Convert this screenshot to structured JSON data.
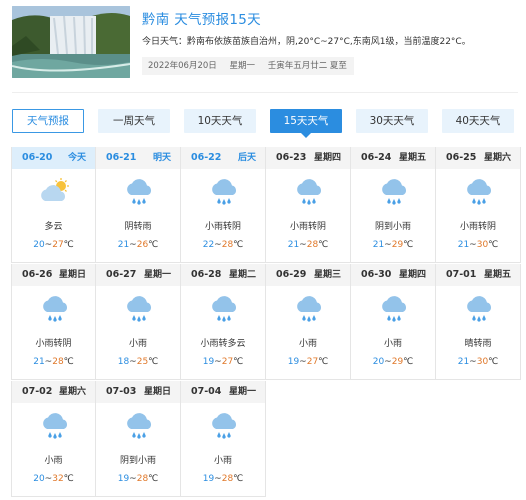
{
  "header": {
    "title": "黔南 天气预报15天",
    "summary": "今日天气：黔南布依族苗族自治州，阴,20°C~27°C,东南风1级，当前温度22°C。",
    "date": "2022年06月20日",
    "weekday": "星期一",
    "lunar": "壬寅年五月廿二 夏至",
    "thumb": "waterfall-photo"
  },
  "tabs": [
    {
      "label": "天气预报",
      "style": "outline"
    },
    {
      "label": "一周天气",
      "style": "normal"
    },
    {
      "label": "10天天气",
      "style": "normal"
    },
    {
      "label": "15天天气",
      "style": "active"
    },
    {
      "label": "30天天气",
      "style": "normal"
    },
    {
      "label": "40天天气",
      "style": "normal"
    }
  ],
  "colors": {
    "accent": "#2b8de0",
    "low_temp": "#2b8de0",
    "high_temp": "#e0782a"
  },
  "days": [
    {
      "date": "06-20",
      "week": "今天",
      "desc": "多云",
      "lo": "20",
      "hi": "27",
      "icon": "partly-cloudy-icon"
    },
    {
      "date": "06-21",
      "week": "明天",
      "desc": "阴转雨",
      "lo": "21",
      "hi": "26",
      "icon": "rain-icon"
    },
    {
      "date": "06-22",
      "week": "后天",
      "desc": "小雨转阴",
      "lo": "22",
      "hi": "28",
      "icon": "rain-icon"
    },
    {
      "date": "06-23",
      "week": "星期四",
      "desc": "小雨转阴",
      "lo": "21",
      "hi": "28",
      "icon": "rain-icon"
    },
    {
      "date": "06-24",
      "week": "星期五",
      "desc": "阴到小雨",
      "lo": "21",
      "hi": "29",
      "icon": "rain-icon"
    },
    {
      "date": "06-25",
      "week": "星期六",
      "desc": "小雨转阴",
      "lo": "21",
      "hi": "30",
      "icon": "rain-icon"
    },
    {
      "date": "06-26",
      "week": "星期日",
      "desc": "小雨转阴",
      "lo": "21",
      "hi": "28",
      "icon": "rain-icon"
    },
    {
      "date": "06-27",
      "week": "星期一",
      "desc": "小雨",
      "lo": "18",
      "hi": "25",
      "icon": "rain-icon"
    },
    {
      "date": "06-28",
      "week": "星期二",
      "desc": "小雨转多云",
      "lo": "19",
      "hi": "27",
      "icon": "rain-icon"
    },
    {
      "date": "06-29",
      "week": "星期三",
      "desc": "小雨",
      "lo": "19",
      "hi": "27",
      "icon": "rain-icon"
    },
    {
      "date": "06-30",
      "week": "星期四",
      "desc": "小雨",
      "lo": "20",
      "hi": "29",
      "icon": "rain-icon"
    },
    {
      "date": "07-01",
      "week": "星期五",
      "desc": "晴转雨",
      "lo": "21",
      "hi": "30",
      "icon": "rain-icon"
    },
    {
      "date": "07-02",
      "week": "星期六",
      "desc": "小雨",
      "lo": "20",
      "hi": "32",
      "icon": "rain-icon"
    },
    {
      "date": "07-03",
      "week": "星期日",
      "desc": "阴到小雨",
      "lo": "19",
      "hi": "28",
      "icon": "rain-icon"
    },
    {
      "date": "07-04",
      "week": "星期一",
      "desc": "小雨",
      "lo": "19",
      "hi": "28",
      "icon": "rain-icon"
    }
  ]
}
